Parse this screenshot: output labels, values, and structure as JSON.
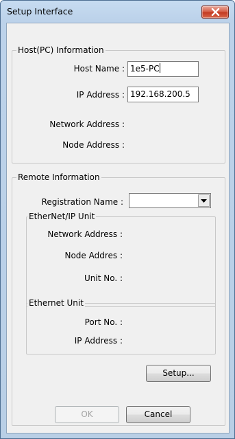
{
  "window": {
    "title": "Setup Interface"
  },
  "host_group": {
    "legend": "Host(PC) Information",
    "host_name_label": "Host Name :",
    "host_name_value": "1e5-PC",
    "ip_address_label": "IP Address :",
    "ip_address_value": "192.168.200.5",
    "network_address_label": "Network Address :",
    "node_address_label": "Node Address :"
  },
  "remote_group": {
    "legend": "Remote Information",
    "registration_name_label": "Registration Name :",
    "registration_name_value": "",
    "ethernetip_unit": {
      "legend": "EtherNet/IP Unit",
      "network_address_label": "Network Address :",
      "node_address_label": "Node Addres :",
      "unit_no_label": "Unit No. :"
    },
    "ethernet_unit": {
      "legend": "Ethernet Unit",
      "port_no_label": "Port No. :",
      "ip_address_label": "IP Address :"
    },
    "setup_button": "Setup..."
  },
  "buttons": {
    "ok": "OK",
    "cancel": "Cancel"
  },
  "icons": {
    "close": "close-icon",
    "dropdown": "chevron-down-icon"
  }
}
